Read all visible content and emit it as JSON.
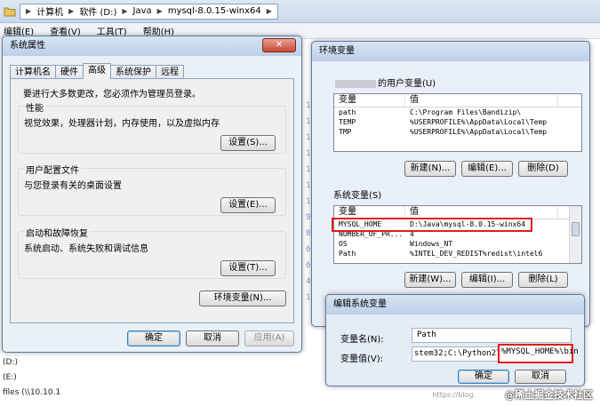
{
  "explorer": {
    "breadcrumbs": [
      "计算机",
      "软件 (D:)",
      "Java",
      "mysql-8.0.15-winx64"
    ],
    "menu": [
      "编辑(E)",
      "查看(V)",
      "工具(T)",
      "帮助(H)"
    ],
    "drives": [
      "(D:)",
      "(E:)",
      "files (\\\\10.10.1"
    ],
    "bg_digits": [
      "1",
      "1",
      "1",
      "1",
      "1",
      "1",
      "1",
      "9",
      "8",
      "6",
      "6",
      "4",
      "1"
    ]
  },
  "sys_props": {
    "title": "系统属性",
    "close_label": "✕",
    "tabs": [
      "计算机名",
      "硬件",
      "高级",
      "系统保护",
      "远程"
    ],
    "admin_note": "要进行大多数更改，您必须作为管理员登录。",
    "performance": {
      "title": "性能",
      "desc": "视觉效果，处理器计划，内存使用，以及虚拟内存",
      "button": "设置(S)..."
    },
    "user_profiles": {
      "title": "用户配置文件",
      "desc": "与您登录有关的桌面设置",
      "button": "设置(E)..."
    },
    "startup": {
      "title": "启动和故障恢复",
      "desc": "系统启动、系统失败和调试信息",
      "button": "设置(T)..."
    },
    "env_button": "环境变量(N)...",
    "ok": "确定",
    "cancel": "取消",
    "apply": "应用(A)"
  },
  "env_vars": {
    "title": "环境变量",
    "user_section": "的用户变量(U)",
    "user_header": [
      "变量",
      "值"
    ],
    "user_rows": [
      [
        "path",
        "C:\\Program Files\\Bandizip\\"
      ],
      [
        "TEMP",
        "%USERPROFILE%\\AppData\\Local\\Temp"
      ],
      [
        "TMP",
        "%USERPROFILE%\\AppData\\Local\\Temp"
      ]
    ],
    "user_buttons": [
      "新建(N)...",
      "编辑(E)...",
      "删除(D)"
    ],
    "sys_section": "系统变量(S)",
    "sys_header": [
      "变量",
      "值"
    ],
    "sys_rows": [
      [
        "MYSQL_HOME",
        "D:\\Java\\mysql-8.0.15-winx64"
      ],
      [
        "NUMBER_OF_PR...",
        "4"
      ],
      [
        "OS",
        "Windows_NT"
      ],
      [
        "Path",
        "%INTEL_DEV_REDIST%redist\\intel6"
      ]
    ],
    "sys_buttons": [
      "新建(W)...",
      "编辑(I)...",
      "删除(L)"
    ]
  },
  "edit_var": {
    "title": "编辑系统变量",
    "name_label": "变量名(N):",
    "name_value": "Path",
    "value_label": "变量值(V):",
    "value_text": "stem32;C:\\Python27",
    "value_highlight": "%MYSQL_HOME%\\bin",
    "ok": "确定",
    "cancel": "取消"
  },
  "watermark": {
    "small": "https://blog.",
    "main": "@稀土掘金技术社区"
  },
  "colors": {
    "highlight": "#e21d1d",
    "window_border": "#5c7aa0"
  }
}
